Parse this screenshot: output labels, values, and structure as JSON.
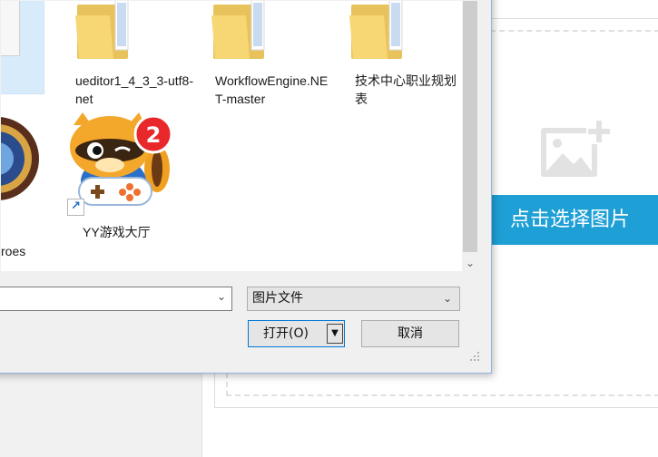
{
  "upload_panel": {
    "button_label": "点击选择图片",
    "placeholder_icon": "add-image-icon"
  },
  "file_dialog": {
    "items": [
      {
        "label": "ueditor1_4_3_3-utf8-net",
        "icon": "folder-icon"
      },
      {
        "label": "WorkflowEngine.NET-master",
        "icon": "folder-icon"
      },
      {
        "label": "技术中心职业规划表",
        "icon": "folder-icon"
      },
      {
        "label": "roes",
        "icon": "game-app-icon"
      },
      {
        "label": "YY游戏大厅",
        "icon": "yy-game-shortcut-icon",
        "badge": "2"
      }
    ],
    "filename": {
      "value": ""
    },
    "filter": {
      "selected": "图片文件"
    },
    "open_label": "打开(O)",
    "cancel_label": "取消"
  },
  "colors": {
    "accent": "#1e9fd6",
    "dialog_border": "#8fb3d9",
    "focus_border": "#0078d7",
    "folder": "#f7d774"
  }
}
